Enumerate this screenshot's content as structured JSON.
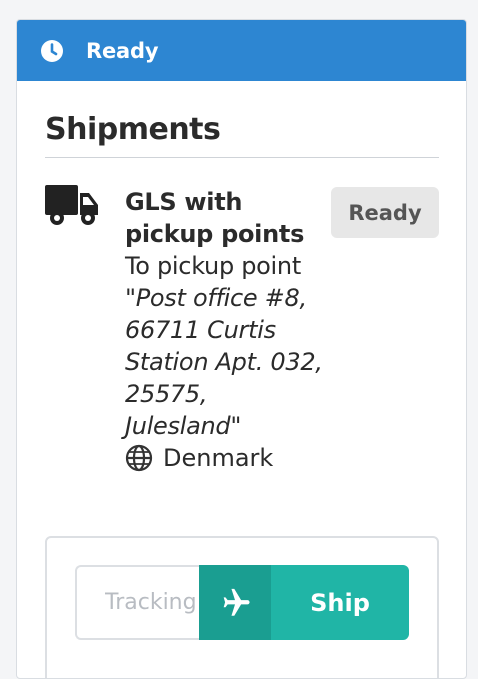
{
  "header": {
    "status_title": "Ready",
    "icon": "clock-icon",
    "color": "#2d86d2"
  },
  "section": {
    "title": "Shipments"
  },
  "shipment": {
    "carrier_icon": "truck-icon",
    "carrier_name": "GLS with pickup points",
    "pickup_prefix": "To pickup point ",
    "pickup_address": "\"Post office #8, 66711 Curtis Station Apt. 032, 25575, Julesland\"",
    "country_icon": "globe-icon",
    "country": "Denmark",
    "status_badge": "Ready"
  },
  "ship_panel": {
    "tracking_placeholder": "Tracking number",
    "tracking_value": "",
    "ship_icon": "airplane-icon",
    "ship_label": "Ship",
    "button_color": "#20b5a6"
  }
}
